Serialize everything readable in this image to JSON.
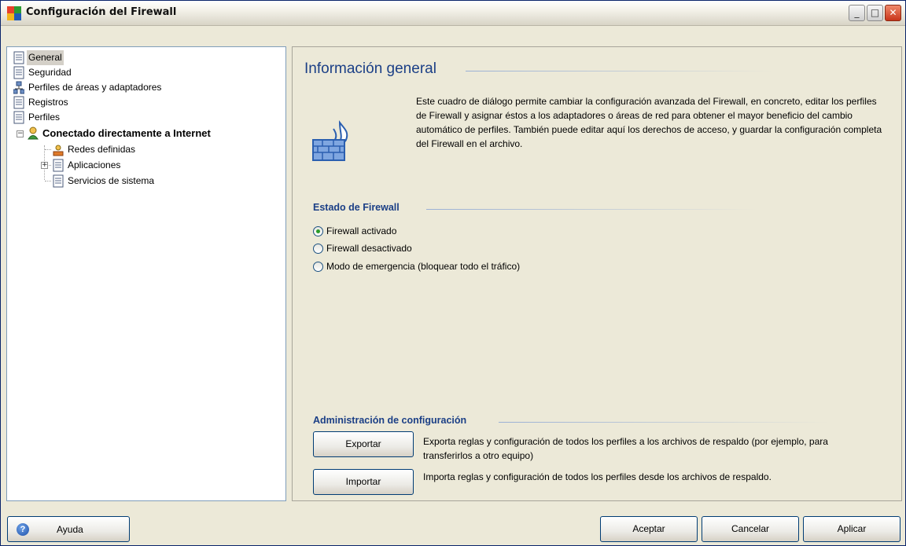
{
  "window": {
    "title": "Configuración del Firewall"
  },
  "tree": {
    "items": [
      {
        "label": "General"
      },
      {
        "label": "Seguridad"
      },
      {
        "label": "Perfiles de áreas y adaptadores"
      },
      {
        "label": "Registros"
      },
      {
        "label": "Perfiles"
      },
      {
        "label": "Conectado directamente a Internet"
      },
      {
        "label": "Redes definidas"
      },
      {
        "label": "Aplicaciones"
      },
      {
        "label": "Servicios de sistema"
      }
    ]
  },
  "main": {
    "title": "Información general",
    "description": "Este cuadro de diálogo permite cambiar la configuración avanzada del Firewall, en concreto, editar los perfiles de Firewall y asignar éstos a los adaptadores o áreas de red para obtener el mayor beneficio del cambio automático de perfiles. También puede editar aquí los derechos de acceso, y guardar la configuración completa del Firewall en el archivo.",
    "status_title": "Estado de Firewall",
    "status_options": [
      {
        "label": "Firewall activado",
        "checked": true
      },
      {
        "label": "Firewall desactivado",
        "checked": false
      },
      {
        "label": "Modo de emergencia (bloquear todo el tráfico)",
        "checked": false
      }
    ],
    "admin_title": "Administración de configuración",
    "export_button": "Exportar",
    "export_desc": "Exporta reglas y configuración de todos los perfiles a los archivos de respaldo (por ejemplo, para transferirlos a otro equipo)",
    "import_button": "Importar",
    "import_desc": "Importa reglas y configuración de todos los perfiles desde los archivos de respaldo."
  },
  "footer": {
    "help_label": "Ayuda",
    "ok_label": "Aceptar",
    "cancel_label": "Cancelar",
    "apply_label": "Aplicar"
  },
  "colors": {
    "accent": "#1b3f86",
    "border": "#7f9db9"
  }
}
